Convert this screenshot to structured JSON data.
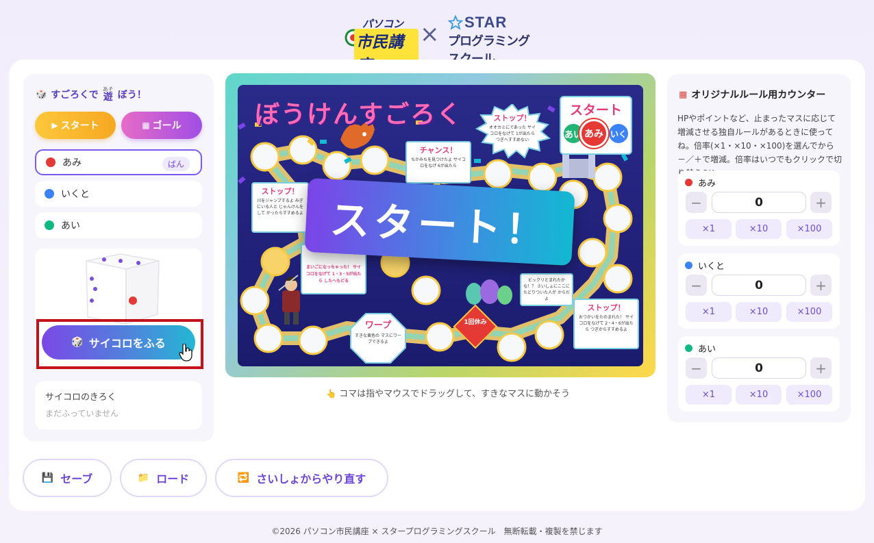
{
  "header": {
    "logo_pc_top": "パソコン",
    "logo_pc_main": "市民講座",
    "logo_cross": "×",
    "logo_star_top": "STAR",
    "logo_star_bottom": "プログラミングスクール"
  },
  "left_panel": {
    "title_prefix": "すごろくで",
    "title_kanji": "遊",
    "title_ruby": "あそ",
    "title_suffix": "ぼう！",
    "start_button": "スタート",
    "goal_button": "ゴール",
    "players": [
      {
        "name": "あみ",
        "color": "#e53935",
        "badge": "ばん"
      },
      {
        "name": "いくと",
        "color": "#3b82f6"
      },
      {
        "name": "あい",
        "color": "#10b981"
      }
    ],
    "roll_button": "サイコロをふる",
    "history_title": "サイコロのきろく",
    "history_empty": "まだふっていません"
  },
  "board": {
    "title": "ぼうけんすごろく",
    "banner": "スタート！",
    "hint": "コマは指やマウスでドラッグして、すきなマスに動かそう",
    "cards": [
      {
        "title": "ストップ！",
        "text": "オオカミにであった サイコロをなげて 1が出たら つぎへすすめない"
      },
      {
        "title": "チャンス！",
        "text": "ちかみちを見つけたよ サイコロをなげ 6が出たら"
      },
      {
        "title": "ストップ！",
        "text": "川をジャンプするよ みぎにいる人と じゃんけんをして かったらすすめるよ"
      },
      {
        "title": "",
        "text": "まいごになっちゃった！ サイコロをなげて 1・3・5が出たら したへもどる"
      },
      {
        "title": "",
        "text": "ビックリとまれたかな！？ さいしょにここに たどりついた人が からだよ"
      },
      {
        "title": "ストップ！",
        "text": "おつかいをたのまれた！ サイコロをなげて 2・4・6が出たら つぎからすすめるよ"
      },
      {
        "title": "ワープ",
        "text": "すきな黄色の マスにワープできるよ"
      },
      {
        "title": "1回休み",
        "text": ""
      },
      {
        "title": "スタート",
        "text": ""
      }
    ],
    "start_tokens": [
      "あみ",
      "あい",
      "いく"
    ]
  },
  "right_panel": {
    "title": "オリジナルルール用カウンター",
    "description": "HPやポイントなど、止まったマスに応じて増減させる独自ルールがあるときに使ってね。倍率(×1・×10・×100)を選んでから－／＋で増減。倍率はいつでもクリックで切り替えOK。",
    "counters": [
      {
        "name": "あみ",
        "color": "#e53935",
        "value": "0"
      },
      {
        "name": "いくと",
        "color": "#3b82f6",
        "value": "0"
      },
      {
        "name": "あい",
        "color": "#10b981",
        "value": "0"
      }
    ],
    "minus": "−",
    "plus": "+",
    "multipliers": [
      "×1",
      "×10",
      "×100"
    ]
  },
  "bottom": {
    "save": "セーブ",
    "load": "ロード",
    "restart": "さいしょからやり直す"
  },
  "footer": "©2026 パソコン市民講座 × スタープログラミングスクール　無断転載・複製を禁じます",
  "colors": {
    "accent": "#7b5af0",
    "roll_gradient_start": "#7b48e6",
    "roll_gradient_end": "#23b7d4",
    "highlight_box": "#c4121a"
  }
}
